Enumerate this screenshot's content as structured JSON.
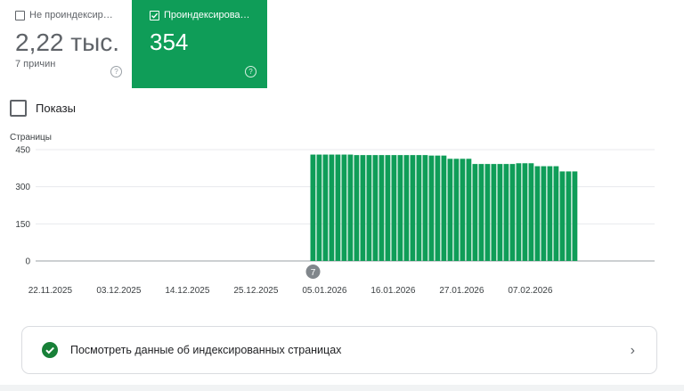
{
  "cards": {
    "not_indexed": {
      "label": "Не проиндексир…",
      "value": "2,22 тыс.",
      "sub": "7 причин",
      "help": "?"
    },
    "indexed": {
      "label": "Проиндексирова…",
      "value": "354",
      "help": "?"
    }
  },
  "impressions_label": "Показы",
  "chart_data": {
    "type": "bar",
    "ylabel": "Страницы",
    "ylim": [
      0,
      450
    ],
    "yticks": [
      "450",
      "300",
      "150",
      "0"
    ],
    "xtick_labels": [
      "22.11.2025",
      "03.12.2025",
      "14.12.2025",
      "25.12.2025",
      "05.01.2026",
      "16.01.2026",
      "27.01.2026",
      "07.02.2026"
    ],
    "annotation": "7",
    "start_date": "2025-11-22",
    "values": [
      0,
      0,
      0,
      0,
      0,
      0,
      0,
      0,
      0,
      0,
      0,
      0,
      0,
      0,
      0,
      0,
      0,
      0,
      0,
      0,
      0,
      0,
      0,
      0,
      0,
      0,
      0,
      0,
      0,
      0,
      0,
      0,
      0,
      0,
      0,
      0,
      0,
      0,
      0,
      0,
      0,
      0,
      0,
      0,
      430,
      430,
      430,
      430,
      430,
      430,
      430,
      428,
      428,
      428,
      428,
      428,
      428,
      428,
      428,
      428,
      428,
      428,
      428,
      426,
      426,
      426,
      413,
      413,
      413,
      413,
      392,
      392,
      392,
      392,
      392,
      392,
      392,
      395,
      395,
      395,
      383,
      383,
      383,
      383,
      362,
      362,
      362
    ],
    "bar_color": "#0f9d58"
  },
  "info_card": {
    "text": "Посмотреть данные об индексированных страницах",
    "chevron": "›"
  },
  "colors": {
    "accent": "#0f9d58",
    "ok": "#188038"
  }
}
